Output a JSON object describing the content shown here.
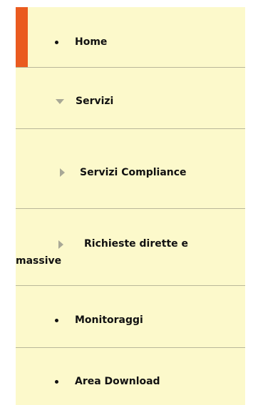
{
  "menu": {
    "items": [
      {
        "label": "Home",
        "icon": "bullet-icon",
        "active": true
      },
      {
        "label": "Servizi",
        "icon": "triangle-down-icon"
      },
      {
        "label": "Servizi Compliance",
        "icon": "triangle-right-icon"
      },
      {
        "label": "Richieste dirette e massive",
        "icon": "triangle-right-icon"
      },
      {
        "label": "Monitoraggi",
        "icon": "bullet-icon"
      },
      {
        "label": "Area Download",
        "icon": "bullet-icon"
      }
    ],
    "colors": {
      "background": "#fcf9cb",
      "active_accent": "#ea5b1f",
      "divider": "#b9b79a",
      "icon_gray": "#a8a896",
      "text": "#111111"
    }
  }
}
